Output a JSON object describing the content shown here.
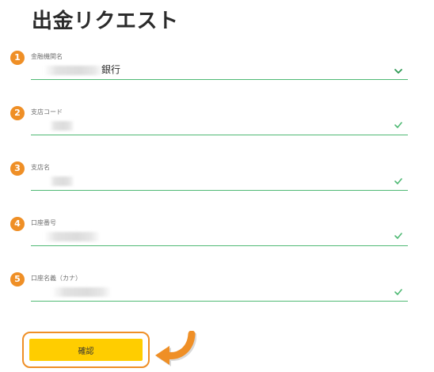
{
  "page": {
    "title": "出金リクエスト"
  },
  "form": {
    "fields": [
      {
        "step": "1",
        "label": "金融機関名",
        "value_suffix": "銀行",
        "control": "select",
        "icon": "chevron-down-icon"
      },
      {
        "step": "2",
        "label": "支店コード",
        "value_suffix": "",
        "control": "text",
        "icon": "check-icon"
      },
      {
        "step": "3",
        "label": "支店名",
        "value_suffix": "",
        "control": "text",
        "icon": "check-icon"
      },
      {
        "step": "4",
        "label": "口座番号",
        "value_suffix": "",
        "control": "text",
        "icon": "check-icon"
      },
      {
        "step": "5",
        "label": "口座名義（カナ）",
        "value_suffix": "",
        "control": "text",
        "icon": "check-icon"
      }
    ],
    "confirm_label": "確認"
  },
  "decorations": {
    "pointer_arrow_icon": "curved-arrow-left-icon"
  },
  "colors": {
    "accent_orange": "#ef8f26",
    "valid_green": "#4fb974",
    "button_yellow": "#ffcd00",
    "title_text": "#2b2b2b"
  }
}
